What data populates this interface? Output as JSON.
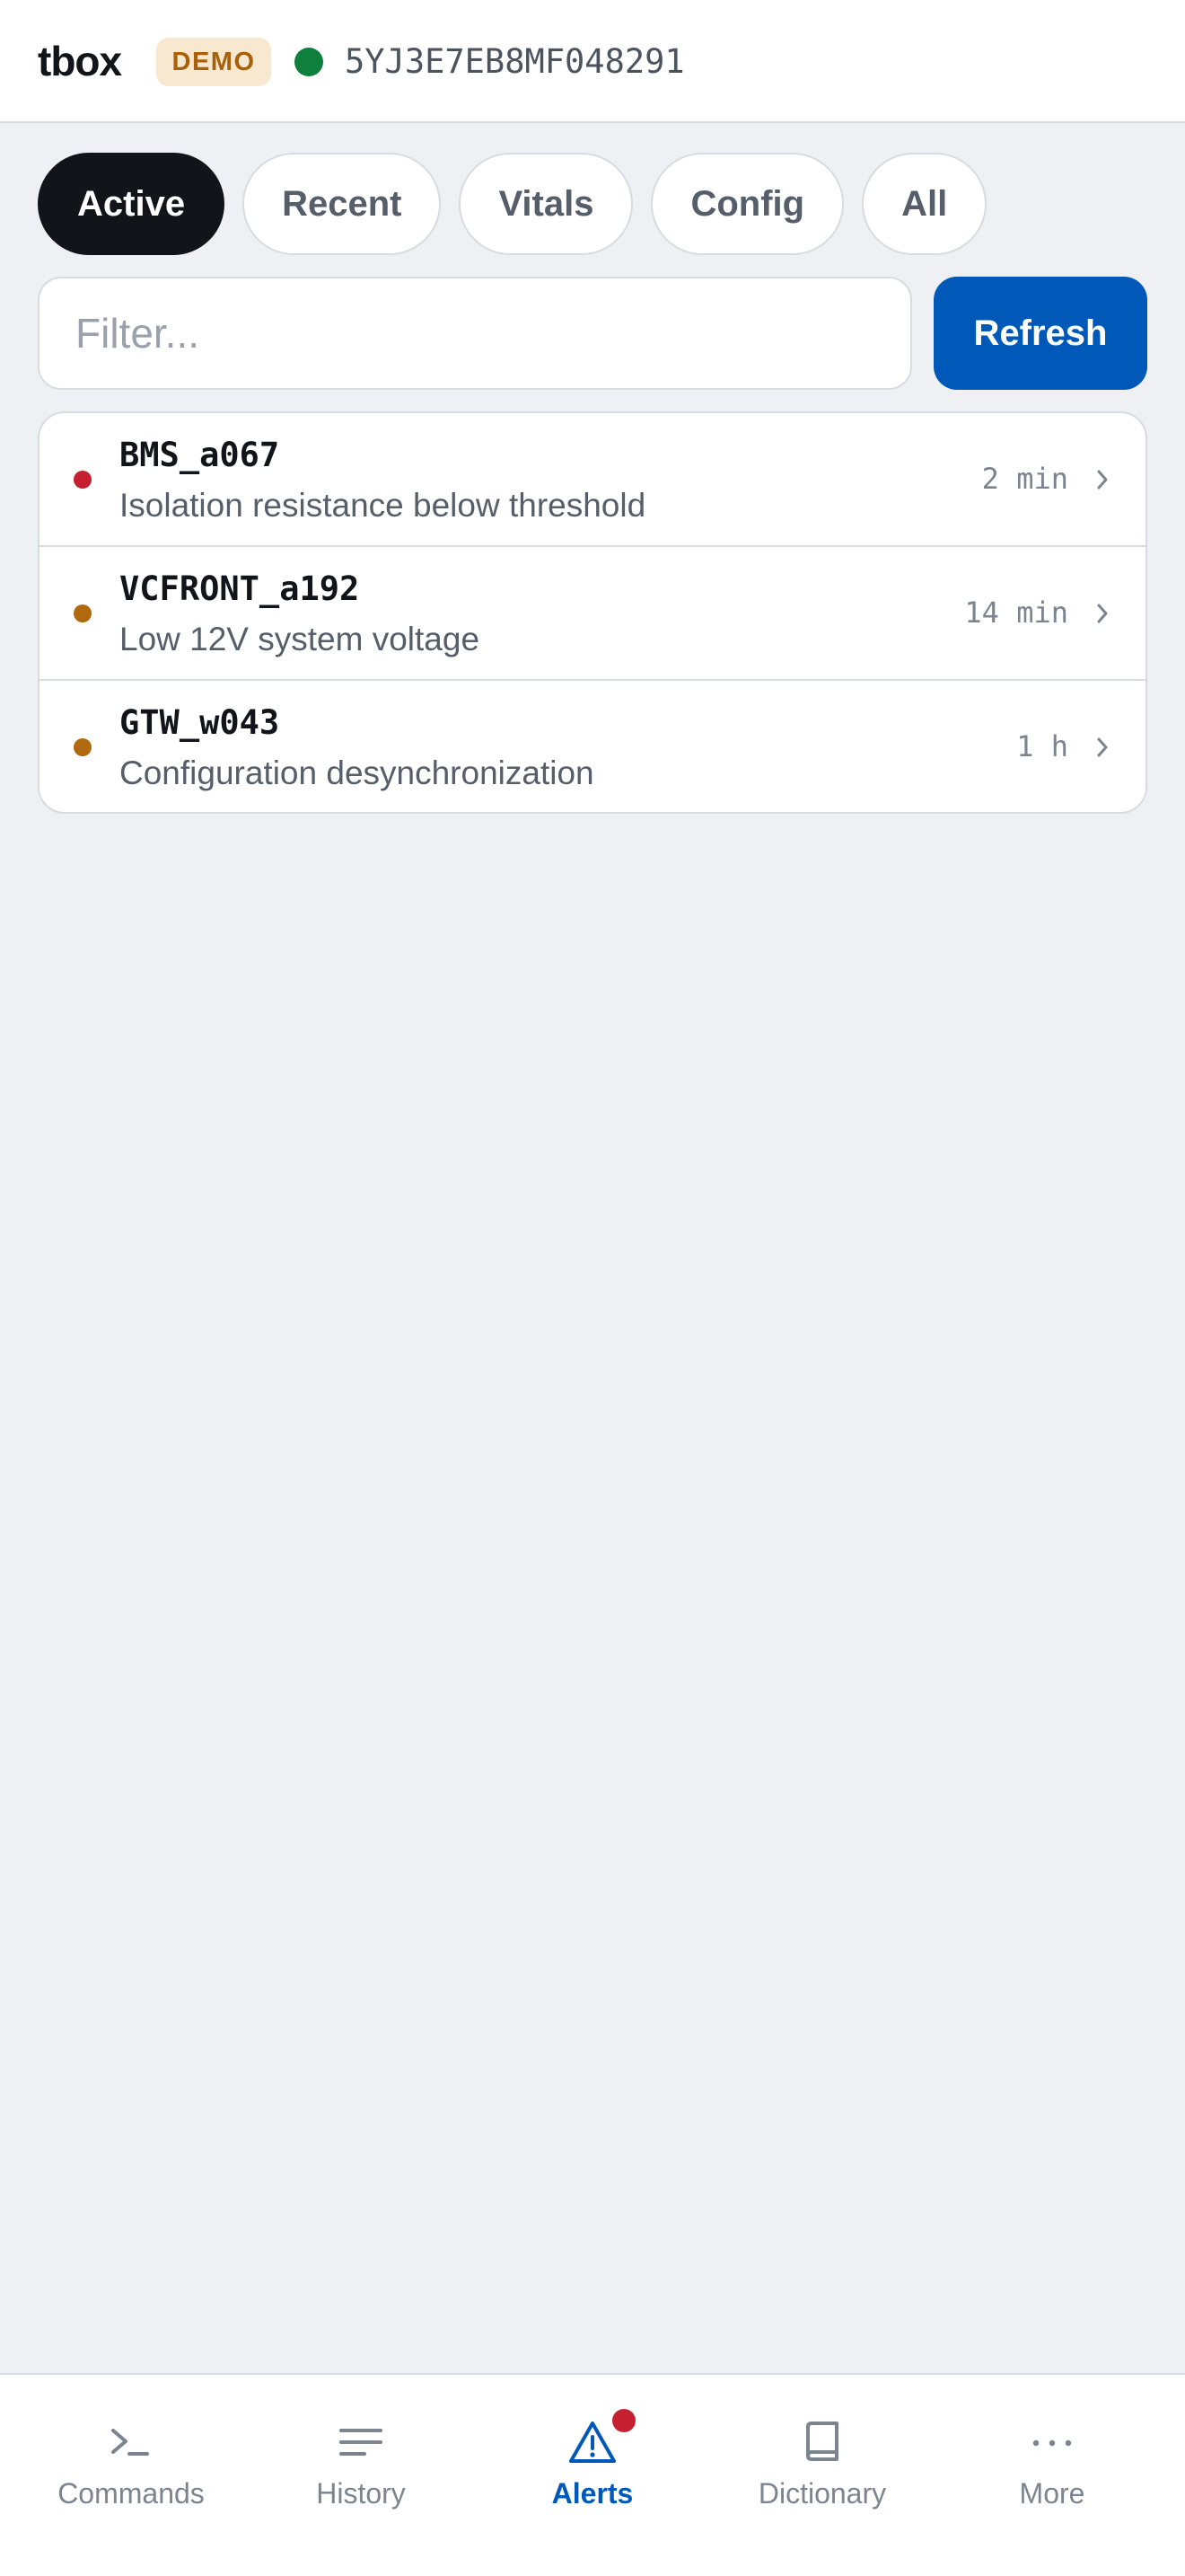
{
  "header": {
    "brand": "tbox",
    "mode_badge": "DEMO",
    "vin": "5YJ3E7EB8MF048291",
    "connection_color": "#0e7f3c"
  },
  "tabs": [
    {
      "label": "Active",
      "active": true
    },
    {
      "label": "Recent",
      "active": false
    },
    {
      "label": "Vitals",
      "active": false
    },
    {
      "label": "Config",
      "active": false
    },
    {
      "label": "All",
      "active": false
    }
  ],
  "filter": {
    "placeholder": "Filter...",
    "value": ""
  },
  "refresh_label": "Refresh",
  "alerts": [
    {
      "code": "BMS_a067",
      "description": "Isolation resistance below threshold",
      "time": "2 min",
      "severity": "critical",
      "severity_color": "#c62030"
    },
    {
      "code": "VCFRONT_a192",
      "description": "Low 12V system voltage",
      "time": "14 min",
      "severity": "warning",
      "severity_color": "#b0690e"
    },
    {
      "code": "GTW_w043",
      "description": "Configuration desynchronization",
      "time": "1 h",
      "severity": "warning",
      "severity_color": "#b0690e"
    }
  ],
  "nav": [
    {
      "label": "Commands",
      "icon": "terminal-icon",
      "active": false
    },
    {
      "label": "History",
      "icon": "list-icon",
      "active": false
    },
    {
      "label": "Alerts",
      "icon": "warning-triangle-icon",
      "active": true,
      "has_badge": true
    },
    {
      "label": "Dictionary",
      "icon": "book-icon",
      "active": false
    },
    {
      "label": "More",
      "icon": "more-dots-icon",
      "active": false
    }
  ],
  "colors": {
    "accent": "#0059b8",
    "active_tab": "#111418",
    "background": "#eef0f4",
    "badge": "#c62030"
  }
}
